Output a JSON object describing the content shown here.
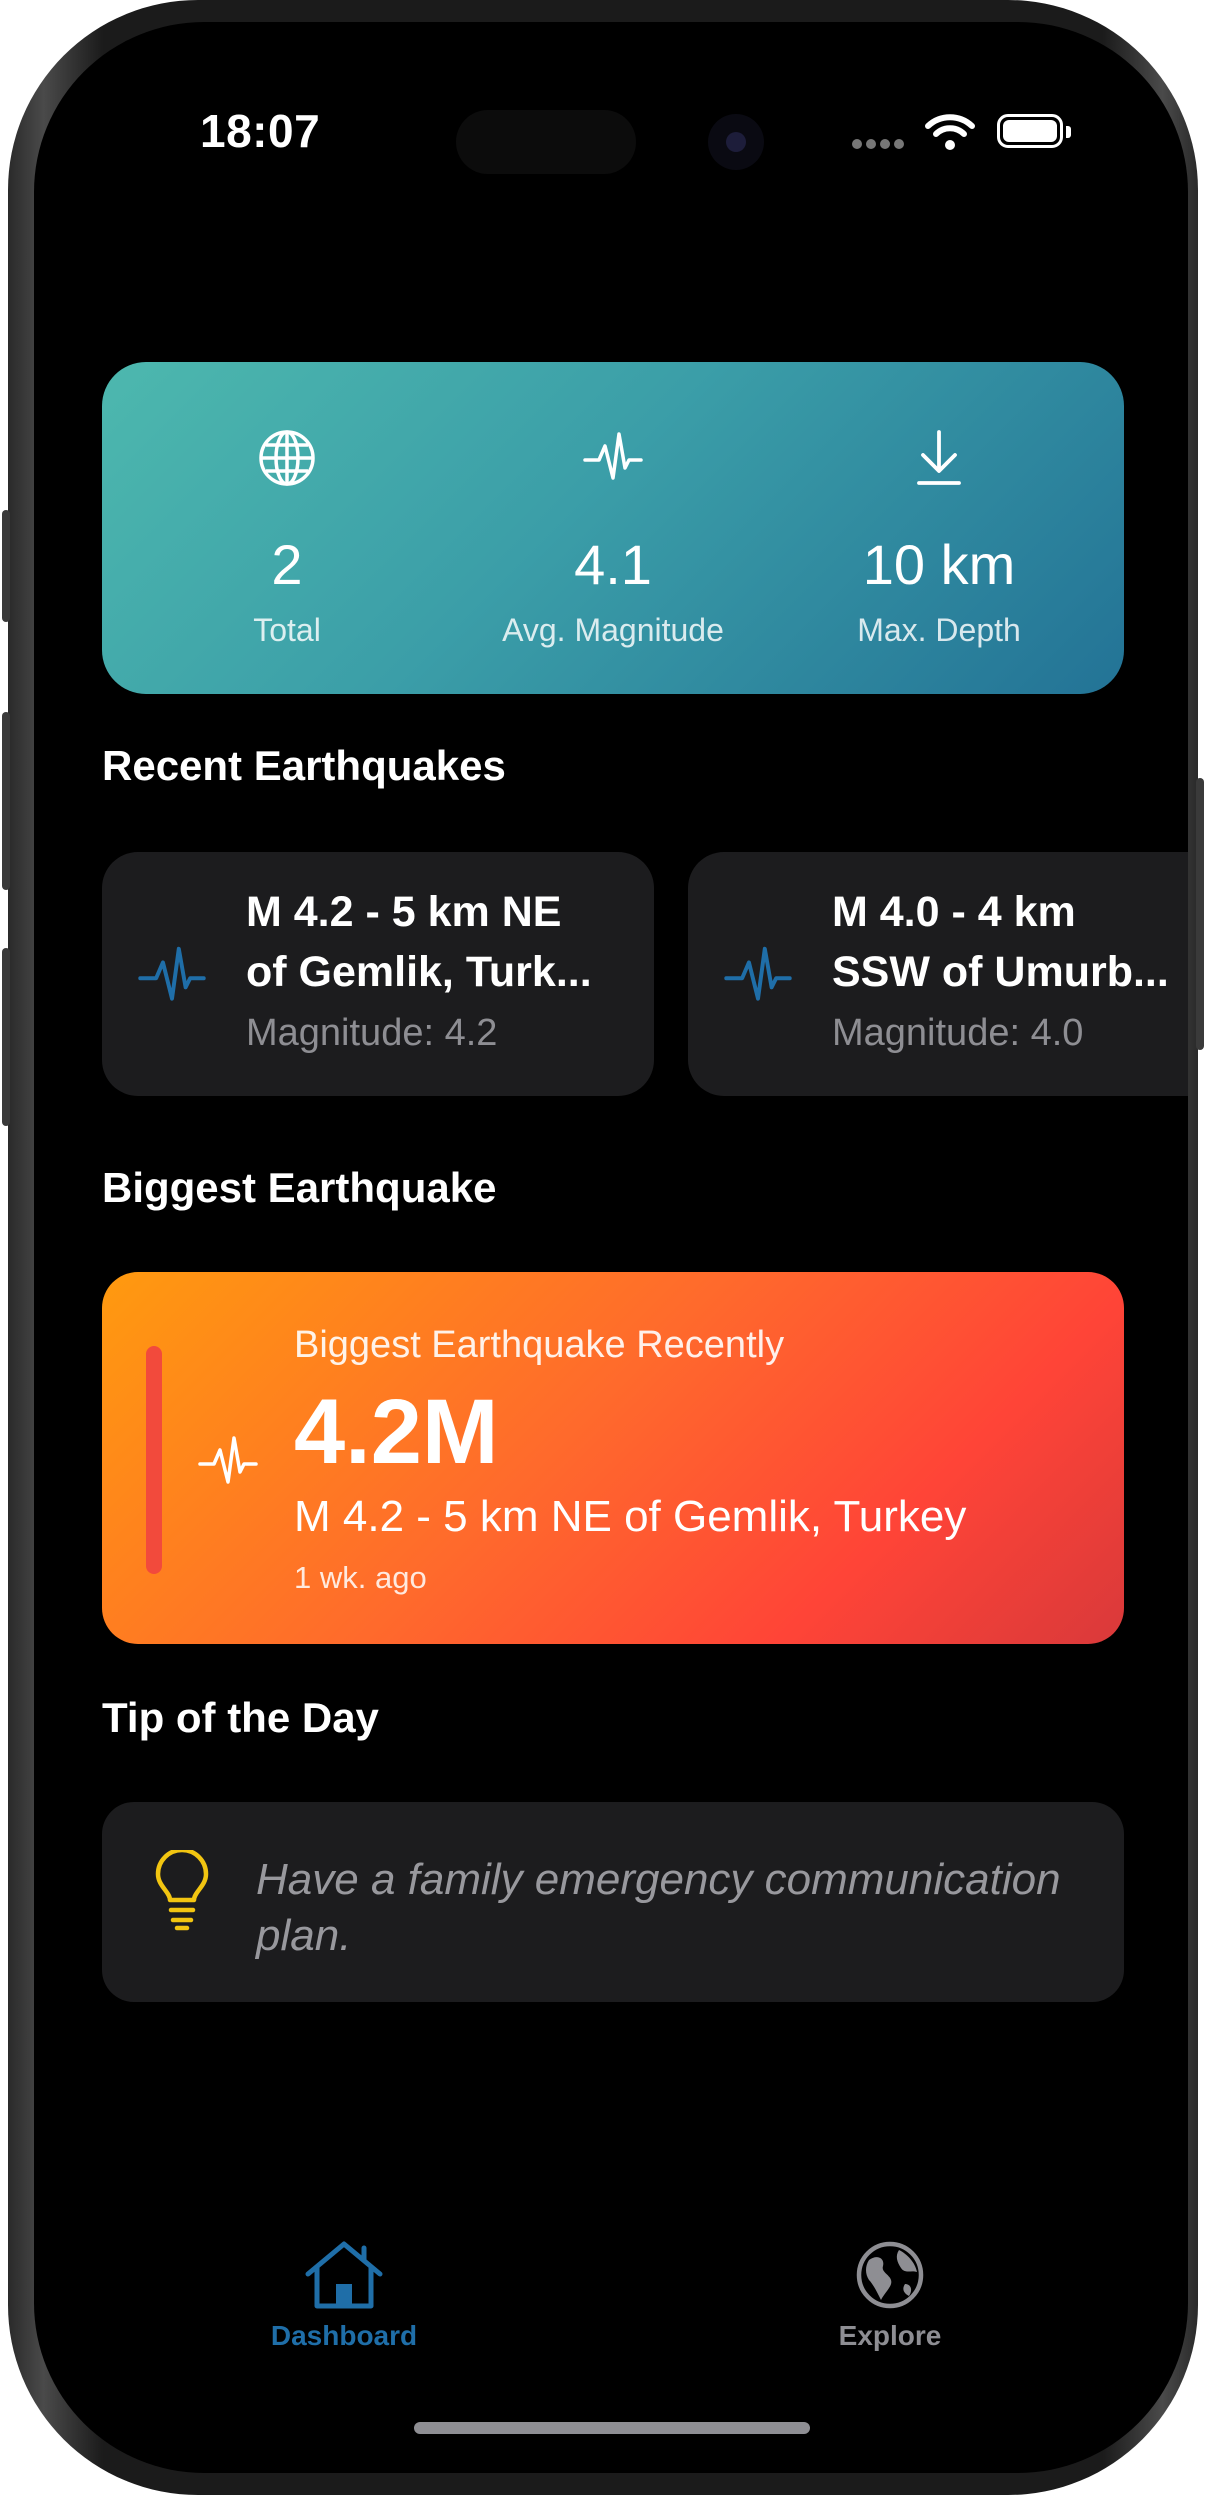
{
  "status_bar": {
    "time": "18:07"
  },
  "stats": [
    {
      "icon": "globe-icon",
      "value": "2",
      "label": "Total"
    },
    {
      "icon": "waveform-icon",
      "value": "4.1",
      "label": "Avg. Magnitude"
    },
    {
      "icon": "arrow-down-icon",
      "value": "10 km",
      "label": "Max. Depth"
    }
  ],
  "recent": {
    "title": "Recent Earthquakes",
    "items": [
      {
        "line1": "M 4.2 - 5 km NE",
        "line2": "of Gemlik, Turk...",
        "magnitude": "Magnitude: 4.2"
      },
      {
        "line1": "M 4.0 - 4 km",
        "line2": "SSW of Umurb...",
        "magnitude": "Magnitude: 4.0"
      }
    ]
  },
  "biggest": {
    "title": "Biggest Earthquake",
    "caption": "Biggest Earthquake Recently",
    "value": "4.2M",
    "name": "M 4.2 - 5 km NE of Gemlik, Turkey",
    "ago": "1 wk. ago"
  },
  "tip": {
    "title": "Tip of the Day",
    "text": "Have a family emergency communication plan."
  },
  "tabs": [
    {
      "label": "Dashboard",
      "icon": "house-icon",
      "selected": true
    },
    {
      "label": "Explore",
      "icon": "globe-americas-icon",
      "selected": false
    }
  ],
  "colors": {
    "accent": "#1f6ea8",
    "card_bg": "#1c1c1e",
    "tip_icon": "#f2c511",
    "inactive_tab": "#8e8e93"
  }
}
